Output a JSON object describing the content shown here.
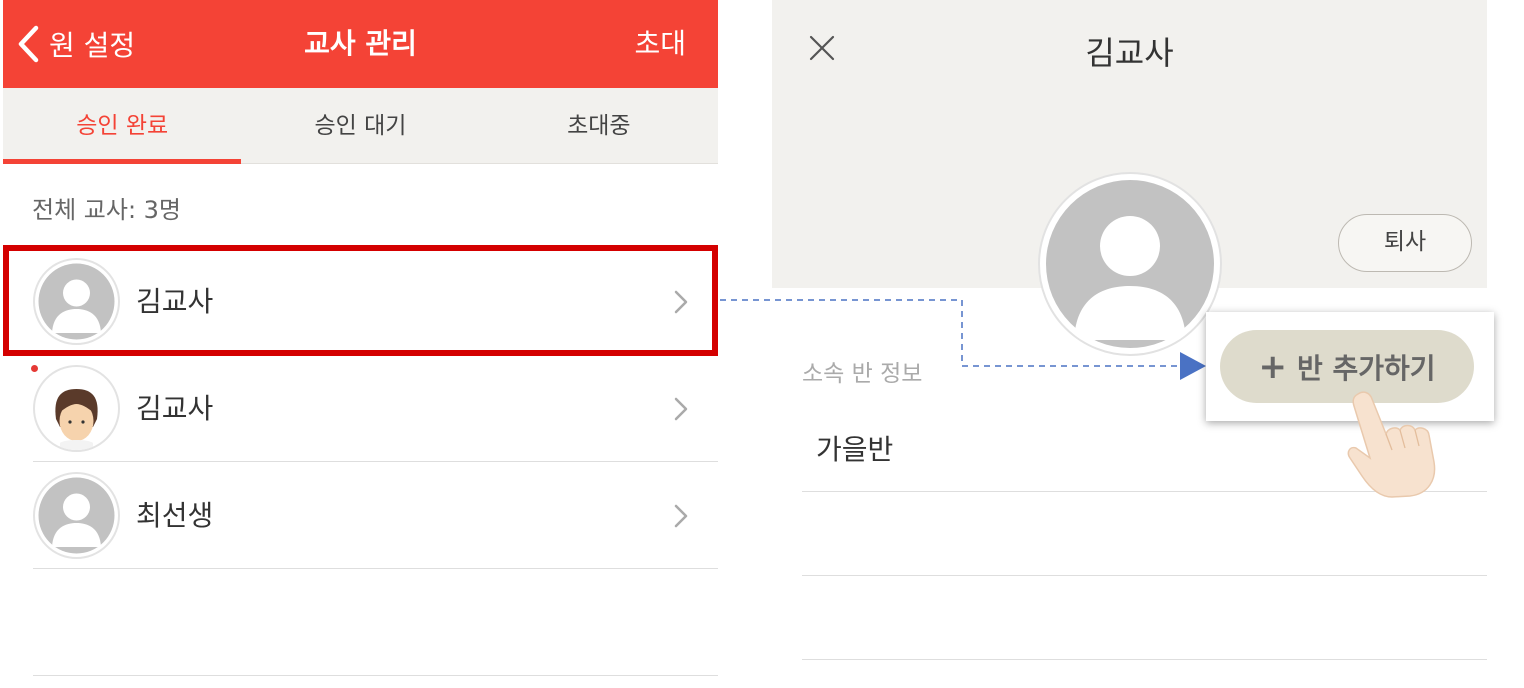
{
  "left_screen": {
    "header": {
      "back_label": "원 설정",
      "title": "교사 관리",
      "invite_label": "초대"
    },
    "tabs": [
      {
        "label": "승인 완료",
        "active": true
      },
      {
        "label": "승인 대기",
        "active": false
      },
      {
        "label": "초대중",
        "active": false
      }
    ],
    "teacher_count": "전체 교사: 3명",
    "teachers": [
      {
        "name": "김교사",
        "avatar": "default-avatar-icon",
        "highlighted": true
      },
      {
        "name": "김교사",
        "avatar": "girl-avatar-icon",
        "highlighted": false
      },
      {
        "name": "최선생",
        "avatar": "default-avatar-icon",
        "highlighted": false
      }
    ]
  },
  "right_screen": {
    "profile_name": "김교사",
    "resign_label": "퇴사",
    "section_label": "소속 반 정보",
    "classes": [
      "가을반",
      "",
      ""
    ],
    "add_class_label": "반 추가하기",
    "add_class_icon": "plus-icon"
  },
  "colors": {
    "accent": "#f44336",
    "highlight_box": "#d40000",
    "connector": "#4a72c4",
    "add_button_bg": "#dedbcc"
  }
}
